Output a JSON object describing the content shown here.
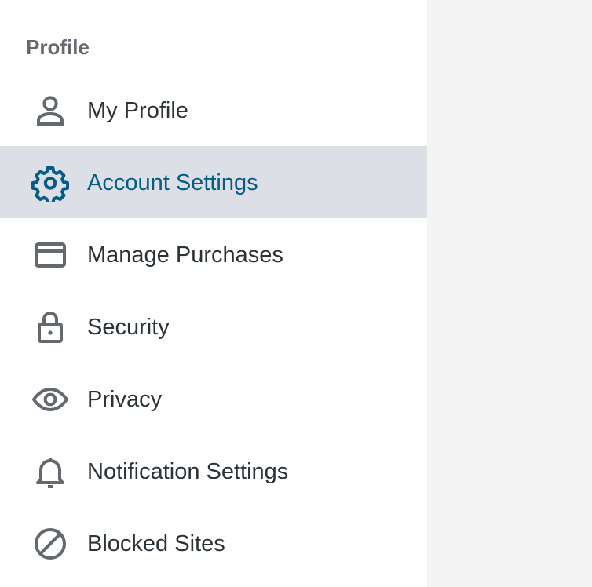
{
  "sidebar": {
    "section_title": "Profile",
    "items": [
      {
        "label": "My Profile",
        "icon": "user-icon",
        "active": false
      },
      {
        "label": "Account Settings",
        "icon": "gear-icon",
        "active": true
      },
      {
        "label": "Manage Purchases",
        "icon": "credit-card-icon",
        "active": false
      },
      {
        "label": "Security",
        "icon": "lock-icon",
        "active": false
      },
      {
        "label": "Privacy",
        "icon": "eye-icon",
        "active": false
      },
      {
        "label": "Notification Settings",
        "icon": "bell-icon",
        "active": false
      },
      {
        "label": "Blocked Sites",
        "icon": "block-icon",
        "active": false
      }
    ]
  },
  "colors": {
    "sidebar_bg": "#ffffff",
    "main_bg": "#f4f4f4",
    "active_bg": "#dcdfe6",
    "active_text": "#065c84",
    "text": "#2c3338",
    "icon": "#646970",
    "section_title": "#646970"
  }
}
